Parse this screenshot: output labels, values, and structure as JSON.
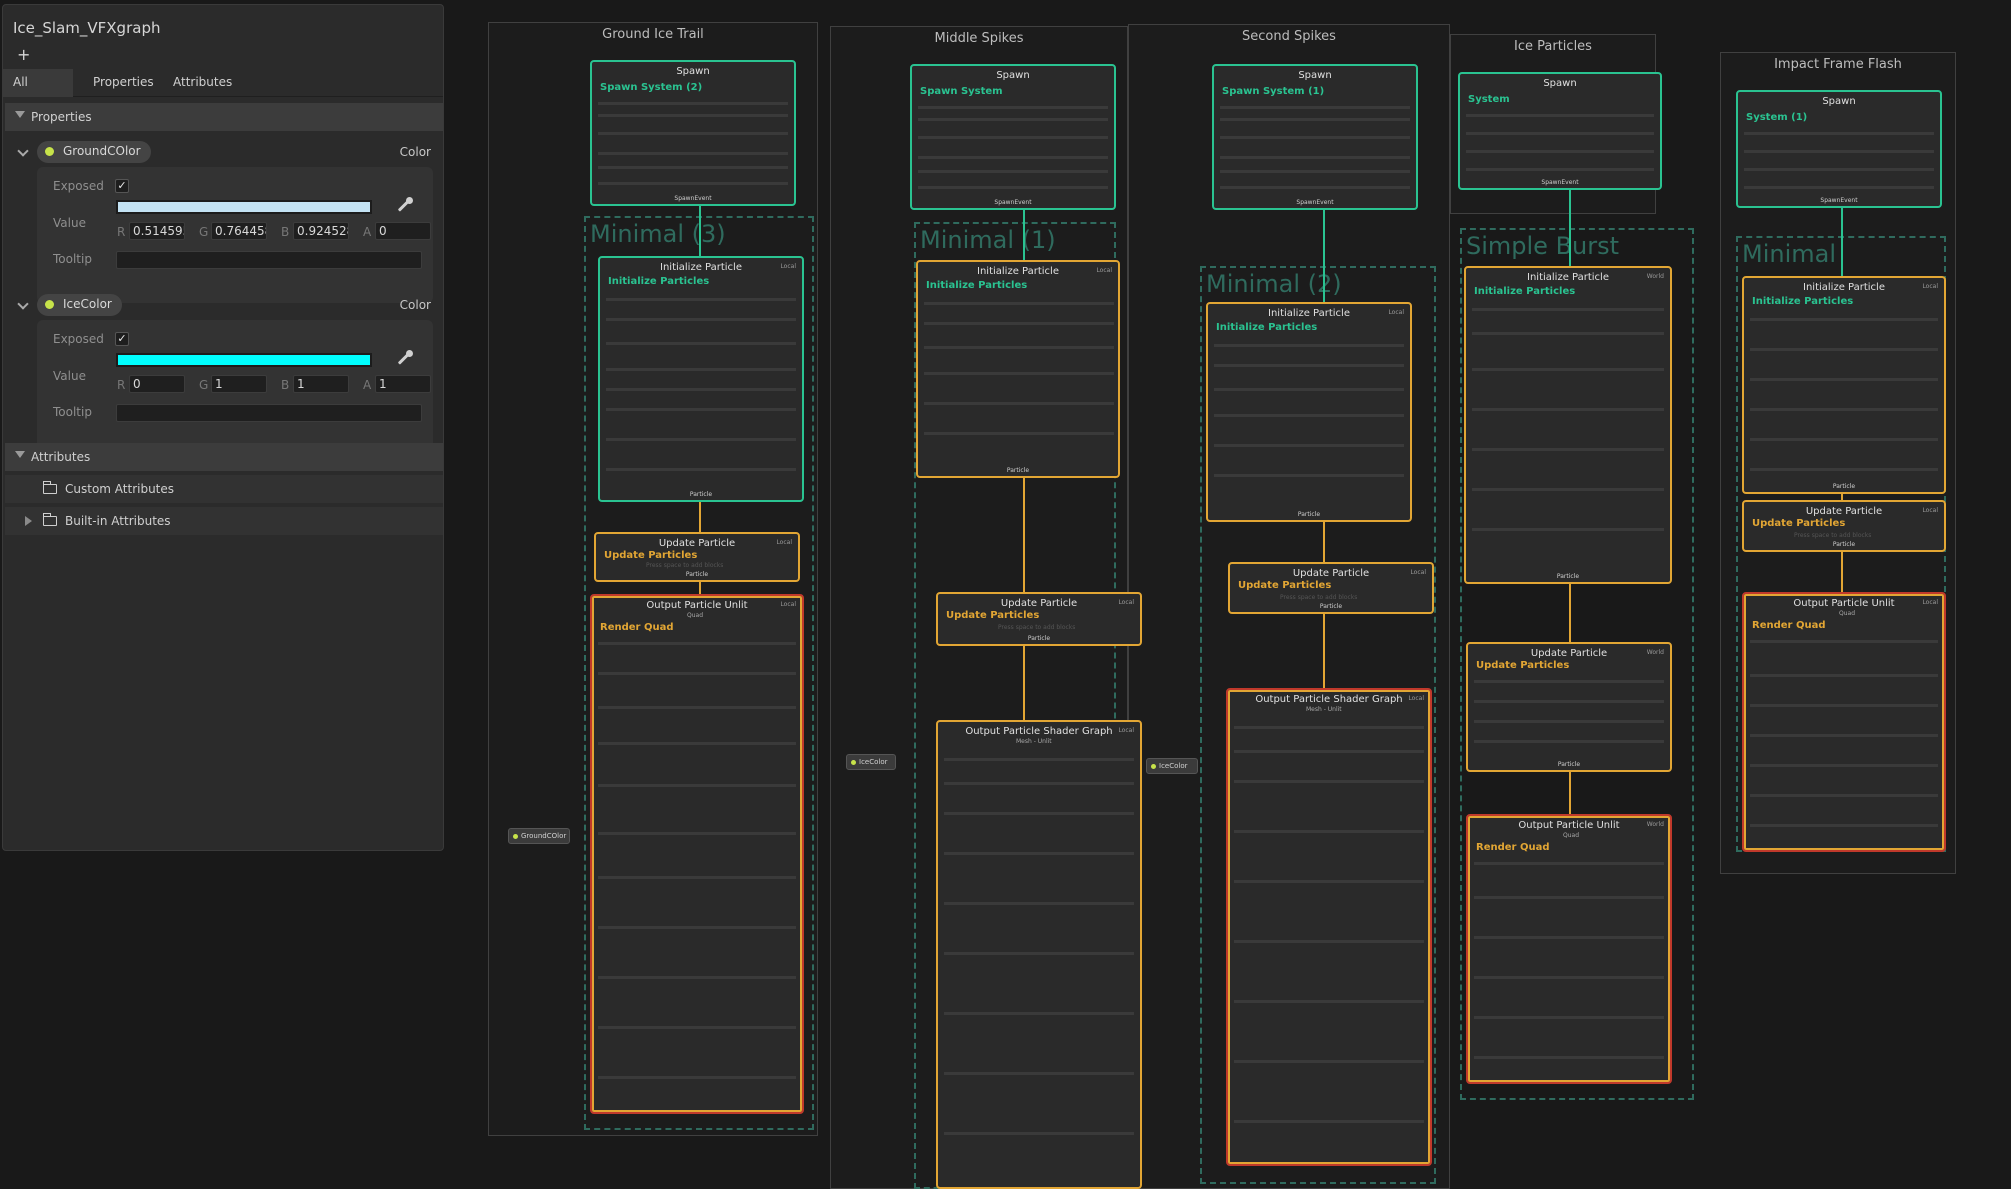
{
  "window": {
    "title": "Ice_Slam_VFXgraph",
    "add_label": "+"
  },
  "tabs": [
    "All",
    "Properties",
    "Attributes"
  ],
  "properties_section": "Properties",
  "props": [
    {
      "name": "GroundCOlor",
      "type": "Color",
      "exposed_label": "Exposed",
      "value_label": "Value",
      "tooltip_label": "Tooltip",
      "swatch_color": "#c3e2f3",
      "r": "0.514595",
      "g": "0.764458",
      "b": "0.924528",
      "a": "0"
    },
    {
      "name": "IceColor",
      "type": "Color",
      "exposed_label": "Exposed",
      "value_label": "Value",
      "tooltip_label": "Tooltip",
      "swatch_color": "#00ffff",
      "r": "0",
      "g": "1",
      "b": "1",
      "a": "1"
    }
  ],
  "channel_labels": [
    "R",
    "G",
    "B",
    "A"
  ],
  "attributes_section": "Attributes",
  "attributes": [
    "Custom Attributes",
    "Built-in Attributes"
  ],
  "graph": {
    "systems": [
      "Ground Ice Trail",
      "Middle Spikes",
      "Second Spikes",
      "Ice Particles",
      "Impact Frame Flash"
    ],
    "groups": [
      "Minimal (3)",
      "Minimal (1)",
      "Minimal (2)",
      "Simple Burst",
      "Minimal"
    ],
    "spawn_title": "Spawn",
    "spawn_subtitles": [
      "Spawn System (2)",
      "Spawn System",
      "Spawn System (1)",
      "System",
      "System (1)"
    ],
    "init_title": "Initialize Particle",
    "init_sub": "Initialize Particles",
    "update_title": "Update Particle",
    "update_sub": "Update Particles",
    "output_unlit": "Output Particle  Unlit",
    "output_unlit_sub": "Quad",
    "output_shader": "Output Particle  Shader Graph",
    "output_shader_sub": "Mesh - Unlit",
    "render_quad": "Render Quad",
    "local": "Local",
    "world": "World",
    "spawn_event": "SpawnEvent",
    "particle": "Particle",
    "press_space": "Press space to add blocks",
    "prop_nodes": [
      "GroundCOlor",
      "IceColor",
      "IceColor"
    ]
  },
  "colors": {
    "accent_green": "#2ac391",
    "accent_orange": "#e2a634",
    "group_teal": "#2f6b5e"
  }
}
